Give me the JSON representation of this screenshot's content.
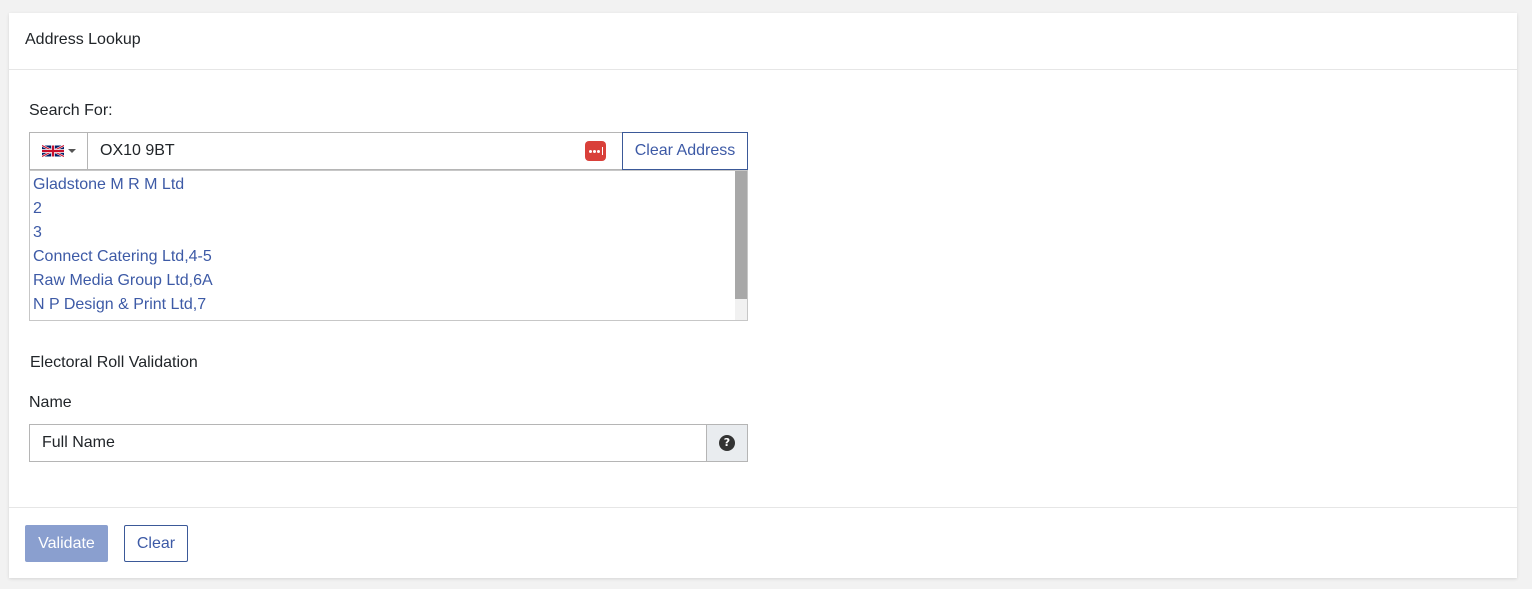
{
  "card": {
    "title": "Address Lookup"
  },
  "search": {
    "label": "Search For:",
    "country_icon": "uk-flag-icon",
    "value": "OX10 9BT",
    "password_manager_icon": "password-manager-icon",
    "clear_address_label": "Clear Address",
    "results": [
      "Gladstone M R M Ltd",
      "2",
      "3",
      "Connect Catering Ltd,4-5",
      "Raw Media Group Ltd,6A",
      "N P Design & Print Ltd,7"
    ]
  },
  "electoral": {
    "section_label": "Electoral Roll Validation",
    "name_label": "Name",
    "name_placeholder": "Full Name",
    "help_icon": "question-circle-icon"
  },
  "footer": {
    "validate_label": "Validate",
    "clear_label": "Clear"
  },
  "colors": {
    "accent": "#3d5aa6",
    "validate_disabled": "#8a9fcf",
    "password_icon": "#d9403a"
  }
}
